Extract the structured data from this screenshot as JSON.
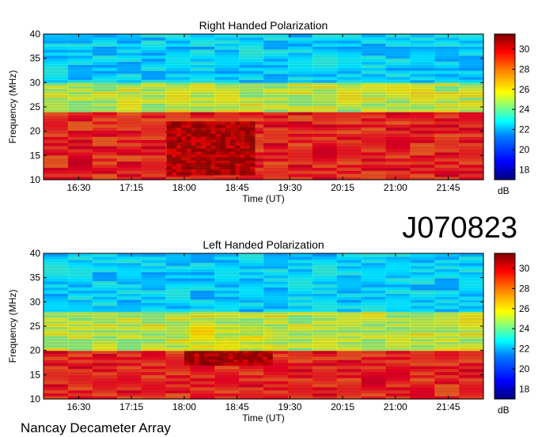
{
  "source_label": "Nancay Decameter Array",
  "observation_id": "J070823",
  "chart_data": [
    {
      "type": "heatmap",
      "title": "Right Handed Polarization",
      "xlabel": "Time (UT)",
      "ylabel": "Frequency (MHz)",
      "colorbar_label": "dB",
      "ylim": [
        10,
        40
      ],
      "xlim": [
        "16:00",
        "22:15"
      ],
      "colorbar_range": [
        17,
        31.5
      ],
      "x_tick_labels": [
        "16:30",
        "17:15",
        "18:00",
        "18:45",
        "19:30",
        "20:15",
        "21:00",
        "21:45"
      ],
      "y_ticks": [
        10,
        15,
        20,
        25,
        30,
        35,
        40
      ],
      "colorbar_ticks": [
        18,
        20,
        22,
        24,
        26,
        28,
        30
      ],
      "colormap": [
        "#00007f",
        "#0000ff",
        "#007fff",
        "#00ffff",
        "#7fff7f",
        "#ffff00",
        "#ff7f00",
        "#ff0000",
        "#7f0000"
      ],
      "emission_zones": [
        {
          "freq_range": [
            10,
            24
          ],
          "time_range": [
            "16:00",
            "22:15"
          ],
          "level": "high"
        },
        {
          "freq_range": [
            11,
            22
          ],
          "time_range": [
            "17:45",
            "19:00"
          ],
          "level": "very high"
        },
        {
          "freq_range": [
            24,
            30
          ],
          "time_range": [
            "16:00",
            "22:15"
          ],
          "level": "medium"
        },
        {
          "freq_range": [
            30,
            40
          ],
          "time_range": [
            "16:00",
            "22:15"
          ],
          "level": "low"
        }
      ]
    },
    {
      "type": "heatmap",
      "title": "Left Handed Polarization",
      "xlabel": "Time (UT)",
      "ylabel": "Frequency (MHz)",
      "colorbar_label": "dB",
      "ylim": [
        10,
        40
      ],
      "xlim": [
        "16:00",
        "22:15"
      ],
      "colorbar_range": [
        17,
        31.5
      ],
      "x_tick_labels": [
        "16:30",
        "17:15",
        "18:00",
        "18:45",
        "19:30",
        "20:15",
        "21:00",
        "21:45"
      ],
      "y_ticks": [
        10,
        15,
        20,
        25,
        30,
        35,
        40
      ],
      "colorbar_ticks": [
        18,
        20,
        22,
        24,
        26,
        28,
        30
      ],
      "colormap": [
        "#00007f",
        "#0000ff",
        "#007fff",
        "#00ffff",
        "#7fff7f",
        "#ffff00",
        "#ff7f00",
        "#ff0000",
        "#7f0000"
      ],
      "emission_zones": [
        {
          "freq_range": [
            10,
            20
          ],
          "time_range": [
            "16:00",
            "22:15"
          ],
          "level": "high"
        },
        {
          "freq_range": [
            17,
            25
          ],
          "time_range": [
            "18:00",
            "19:15"
          ],
          "level": "very high"
        },
        {
          "freq_range": [
            20,
            28
          ],
          "time_range": [
            "16:00",
            "22:15"
          ],
          "level": "medium"
        },
        {
          "freq_range": [
            28,
            40
          ],
          "time_range": [
            "16:00",
            "22:15"
          ],
          "level": "low"
        }
      ]
    }
  ]
}
